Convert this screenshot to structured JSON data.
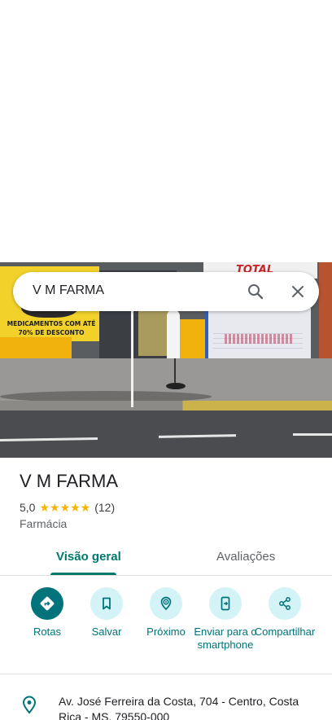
{
  "search": {
    "query": "V M FARMA"
  },
  "photo": {
    "banner_text_line1": "MEDICAMENTOS COM ATÉ",
    "banner_text_line2": "70% DE DESCONTO",
    "sign_text": "TOTAL"
  },
  "place": {
    "name": "V M FARMA",
    "rating": "5,0",
    "stars": "★★★★★",
    "review_count": "(12)",
    "category": "Farmácia"
  },
  "tabs": [
    {
      "label": "Visão geral",
      "active": true
    },
    {
      "label": "Avaliações",
      "active": false
    }
  ],
  "actions": [
    {
      "label": "Rotas",
      "icon": "directions-icon"
    },
    {
      "label": "Salvar",
      "icon": "bookmark-icon"
    },
    {
      "label": "Próximo",
      "icon": "nearby-icon"
    },
    {
      "label": "Enviar para o smartphone",
      "icon": "send-to-phone-icon"
    },
    {
      "label": "Compartilhar",
      "icon": "share-icon"
    }
  ],
  "address": {
    "text": "Av. José Ferreira da Costa, 704 - Centro, Costa Rica - MS, 79550-000"
  },
  "colors": {
    "accent": "#00737b",
    "tab_active": "#00796b",
    "star": "#f4b400",
    "action_bg": "#d4f3f7"
  }
}
